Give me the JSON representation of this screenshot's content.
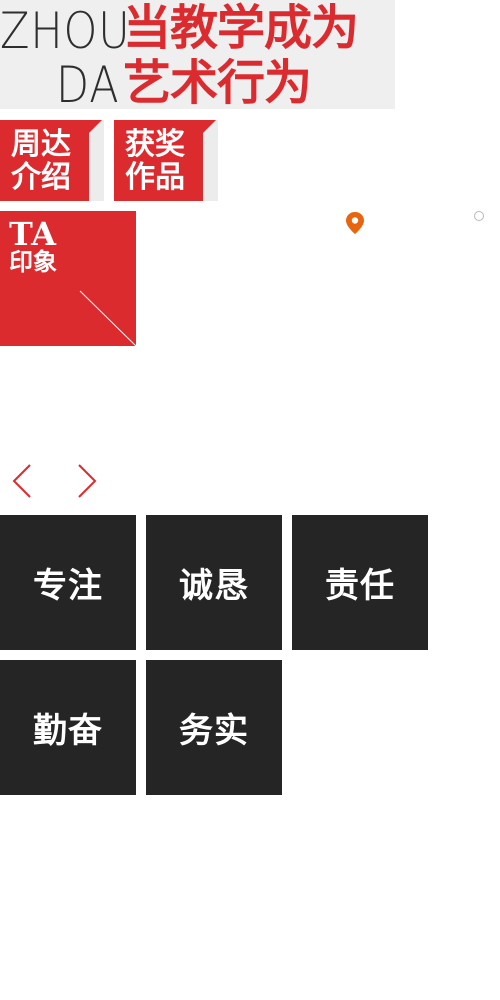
{
  "banner": {
    "latin_line1": "ZHOU",
    "latin_line2": "DA",
    "slogan_line1": "当教学成为",
    "slogan_line2": "艺术行为"
  },
  "nav": {
    "intro_line1": "周达",
    "intro_line2": "介绍",
    "award_line1": "获奖",
    "award_line2": "作品",
    "impression_line1": "TA",
    "impression_line2": "印象"
  },
  "icons": {
    "location": "location-pin-icon",
    "carousel_dot": "carousel-dot-icon",
    "prev": "chevron-left-icon",
    "next": "chevron-right-icon"
  },
  "values": [
    "专注",
    "诚恳",
    "责任",
    "勤奋",
    "务实"
  ],
  "colors": {
    "brand_red": "#db2b2f",
    "tile_dark": "#252525",
    "banner_bg": "#efefef",
    "pin_orange": "#e8650e"
  }
}
